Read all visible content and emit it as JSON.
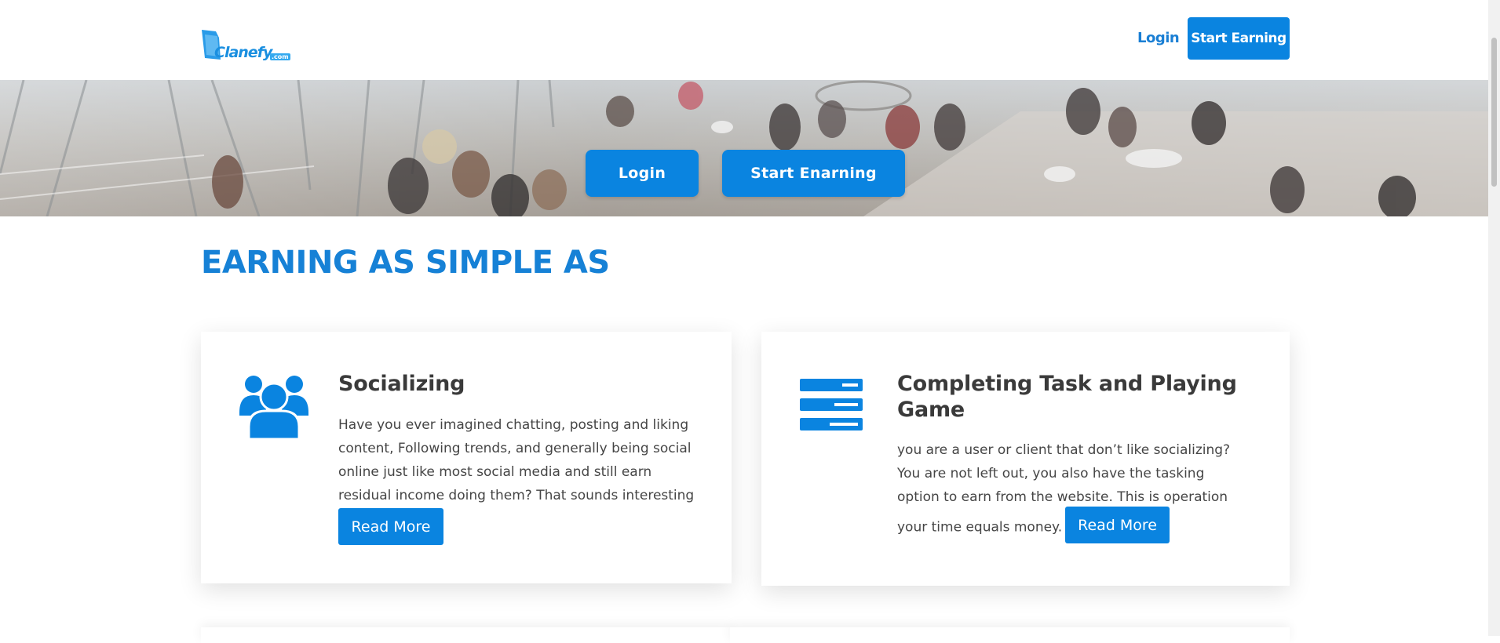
{
  "header": {
    "logo_text": "Clanefy",
    "logo_suffix": ".com",
    "login_label": "Login",
    "start_label": "Start Earning"
  },
  "hero": {
    "login_label": "Login",
    "start_label": "Start Enarning"
  },
  "section": {
    "title": "EARNING AS SIMPLE AS"
  },
  "cards": [
    {
      "icon": "users-icon",
      "title": "Socializing",
      "text": "Have you ever imagined chatting, posting and liking content, Following trends, and generally being social online just like most social media and still earn residual income doing them? That sounds interesting to hear.",
      "button_label": "Read More"
    },
    {
      "icon": "list-icon",
      "title": "Completing Task and Playing Game",
      "text": "you are a user or client that don’t like socializing? You are not left out, you also have the tasking option to earn from the website. This is operation your time equals money.",
      "button_label": "Read More"
    }
  ],
  "colors": {
    "accent": "#0a84e0",
    "title": "#1681d6",
    "heading": "#3a3a3a"
  }
}
